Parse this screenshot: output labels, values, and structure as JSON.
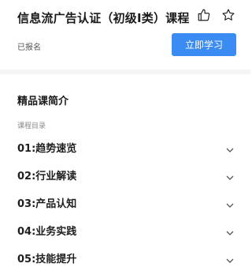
{
  "course": {
    "title": "信息流广告认证（初级I类）课程",
    "enrolled_text": "已报名",
    "study_button": "立即学习",
    "like_icon": "thumbs-up-icon",
    "favorite_icon": "star-icon"
  },
  "intro": {
    "heading": "精品课简介",
    "catalog_label": "课程目录"
  },
  "chapters": [
    {
      "label": "01:趋势速览"
    },
    {
      "label": "02:行业解读"
    },
    {
      "label": "03:产品认知"
    },
    {
      "label": "04:业务实践"
    },
    {
      "label": "05:技能提升"
    }
  ],
  "colors": {
    "accent": "#3a8bf2",
    "divider": "#f5f5f5"
  }
}
